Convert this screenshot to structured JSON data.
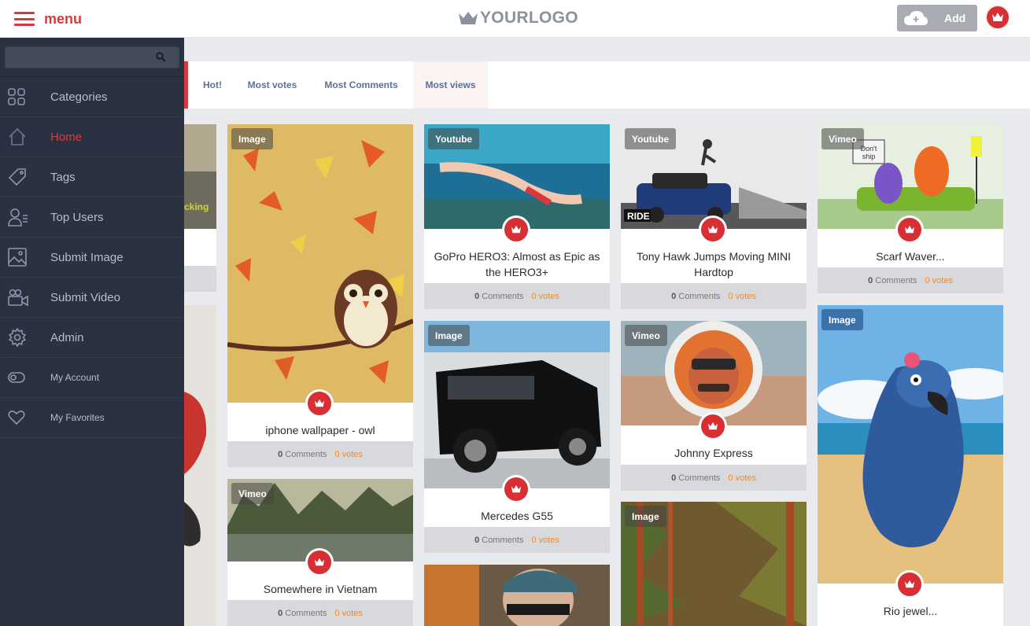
{
  "header": {
    "menu_label": "menu",
    "logo_text": "YOURLOGO",
    "add_label": "Add"
  },
  "sidebar": {
    "search_placeholder": "",
    "items": [
      {
        "label": "Categories",
        "icon": "grid-icon"
      },
      {
        "label": "Home",
        "icon": "home-icon",
        "active": true
      },
      {
        "label": "Tags",
        "icon": "tag-icon"
      },
      {
        "label": "Top Users",
        "icon": "users-icon"
      },
      {
        "label": "Submit Image",
        "icon": "image-icon"
      },
      {
        "label": "Submit Video",
        "icon": "video-camera-icon"
      },
      {
        "label": "Admin",
        "icon": "gear-icon"
      },
      {
        "label": "My Account",
        "icon": "toggle-icon"
      },
      {
        "label": "My Favorites",
        "icon": "heart-icon"
      }
    ]
  },
  "tabs": [
    "Hot!",
    "Most votes",
    "Most Comments",
    "Most views"
  ],
  "active_tab": "Most views",
  "partial_text": "cking",
  "cards": [
    {
      "badge": "Image",
      "title": "iphone wallpaper - owl",
      "comments": "0",
      "votes": "0"
    },
    {
      "badge": "Vimeo",
      "title": "Somewhere in Vietnam",
      "comments": "0",
      "votes": "0"
    },
    {
      "badge": "Youtube",
      "title": "GoPro HERO3: Almost as Epic as the HERO3+",
      "comments": "0",
      "votes": "0"
    },
    {
      "badge": "Image",
      "title": "Mercedes G55",
      "comments": "0",
      "votes": "0"
    },
    {
      "badge": "Youtube",
      "title": "Tony Hawk Jumps Moving MINI Hardtop",
      "comments": "0",
      "votes": "0",
      "overlay_text": "RIDE"
    },
    {
      "badge": "Vimeo",
      "title": "Johnny Express",
      "comments": "0",
      "votes": "0"
    },
    {
      "badge": "Image",
      "title": "",
      "comments": "",
      "votes": ""
    },
    {
      "badge": "Vimeo",
      "title": "Scarf Waver...",
      "comments": "0",
      "votes": "0",
      "overlay_text": "Don't ship"
    },
    {
      "badge": "Image",
      "title": "Rio jewel...",
      "comments": "",
      "votes": ""
    }
  ],
  "labels": {
    "comments": "Comments",
    "votes": "votes"
  },
  "colors": {
    "accent": "#d9383c",
    "sidebar_bg": "#2a3140",
    "votes": "#ee8c28"
  }
}
